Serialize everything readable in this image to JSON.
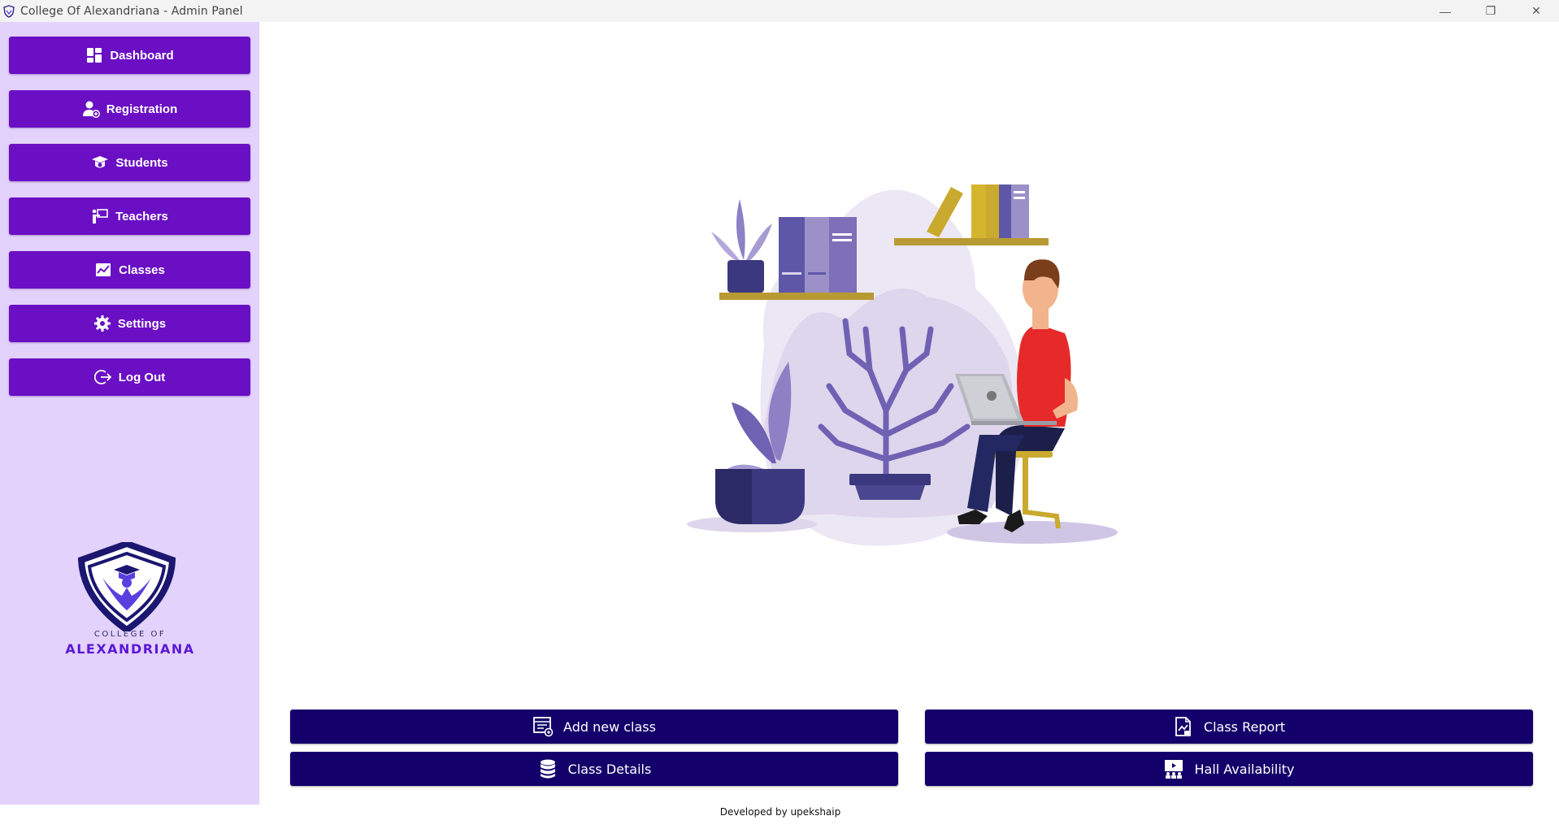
{
  "window": {
    "title": "College Of Alexandriana - Admin Panel",
    "controls": {
      "minimize": "—",
      "restore": "❐",
      "close": "✕"
    }
  },
  "sidebar": {
    "items": [
      {
        "label": "Dashboard",
        "icon": "dashboard-icon"
      },
      {
        "label": "Registration",
        "icon": "add-user-icon"
      },
      {
        "label": "Students",
        "icon": "graduation-cap-icon"
      },
      {
        "label": "Teachers",
        "icon": "teacher-icon"
      },
      {
        "label": "Classes",
        "icon": "chart-icon"
      },
      {
        "label": "Settings",
        "icon": "gear-icon"
      },
      {
        "label": "Log Out",
        "icon": "logout-icon"
      }
    ],
    "logo": {
      "line1": "COLLEGE OF",
      "line2": "ALEXANDRIANA"
    }
  },
  "actions": {
    "add_new_class": "Add new class",
    "class_report": "Class Report",
    "class_details": "Class Details",
    "hall_availability": "Hall Availability"
  },
  "footer": {
    "credit": "Developed by upekshaip"
  },
  "colors": {
    "sidebar_bg": "#e3d2fb",
    "nav_button": "#6a0fc4",
    "action_button": "#14006a",
    "logo_text": "#5a17d6"
  }
}
